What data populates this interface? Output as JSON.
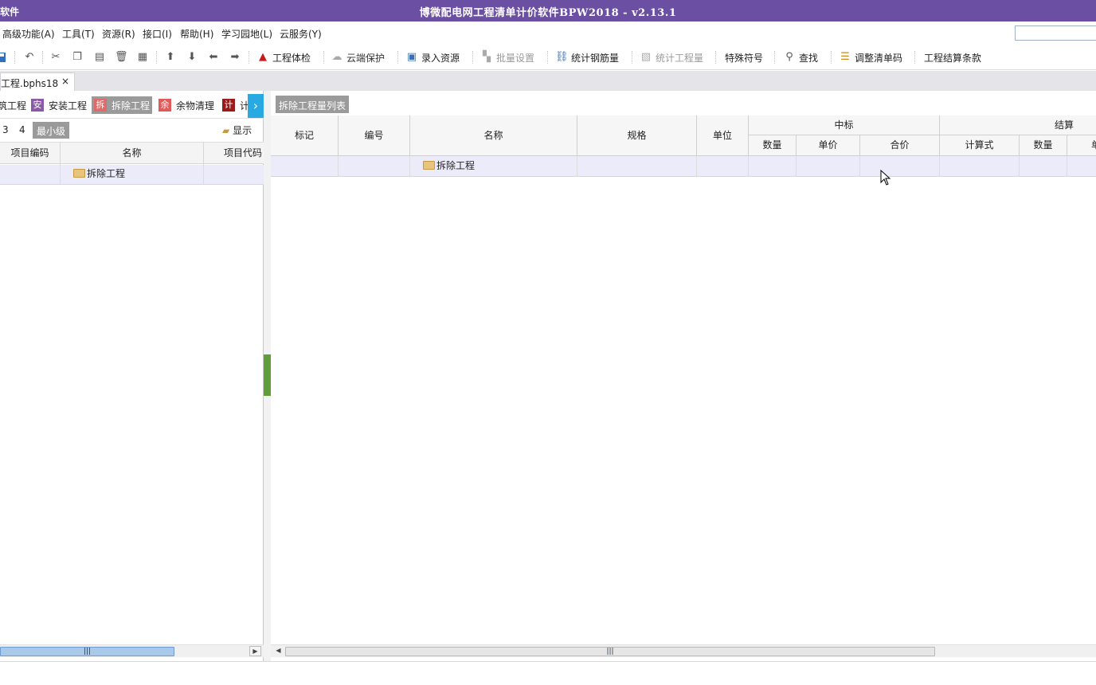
{
  "window": {
    "app_short": "软件",
    "title": "博微配电网工程清单计价软件BPW2018 - v2.13.1"
  },
  "menu": [
    "高级功能(A)",
    "工具(T)",
    "资源(R)",
    "接口(I)",
    "帮助(H)",
    "学习园地(L)",
    "云服务(Y)"
  ],
  "toolbar": {
    "check": "工程体检",
    "cloud_protect": "云端保护",
    "enter_resource": "录入资源",
    "batch_settings": "批量设置",
    "count_rebar": "统计钢筋量",
    "count_quantity": "统计工程量",
    "special_symbols": "特殊符号",
    "find": "查找",
    "adjust_codes": "调整清单码",
    "settlement_terms": "工程结算条款"
  },
  "document_tab": {
    "label": "工程.bphs18",
    "close": "×"
  },
  "category_tabs": [
    {
      "label": "筑工程",
      "badge": ""
    },
    {
      "label": "安装工程",
      "badge": "安"
    },
    {
      "label": "拆除工程",
      "badge": "拆"
    },
    {
      "label": "余物清理",
      "badge": "余"
    },
    {
      "label": "计",
      "badge": "计"
    }
  ],
  "levels": {
    "l3": "3",
    "l4": "4",
    "min": "最小级",
    "show": "显示"
  },
  "left_table": {
    "headers": [
      "项目编码",
      "名称",
      "项目代码"
    ],
    "row_name": "拆除工程"
  },
  "right_panel": {
    "tab": "拆除工程量列表",
    "headers": {
      "mark": "标记",
      "code": "编号",
      "name": "名称",
      "spec": "规格",
      "unit": "单位",
      "bid_group": "中标",
      "bid_qty": "数量",
      "bid_price": "单价",
      "bid_total": "合价",
      "settle_group": "结算",
      "settle_formula": "计算式",
      "settle_qty": "数量",
      "settle_price": "单"
    },
    "row_name": "拆除工程"
  }
}
